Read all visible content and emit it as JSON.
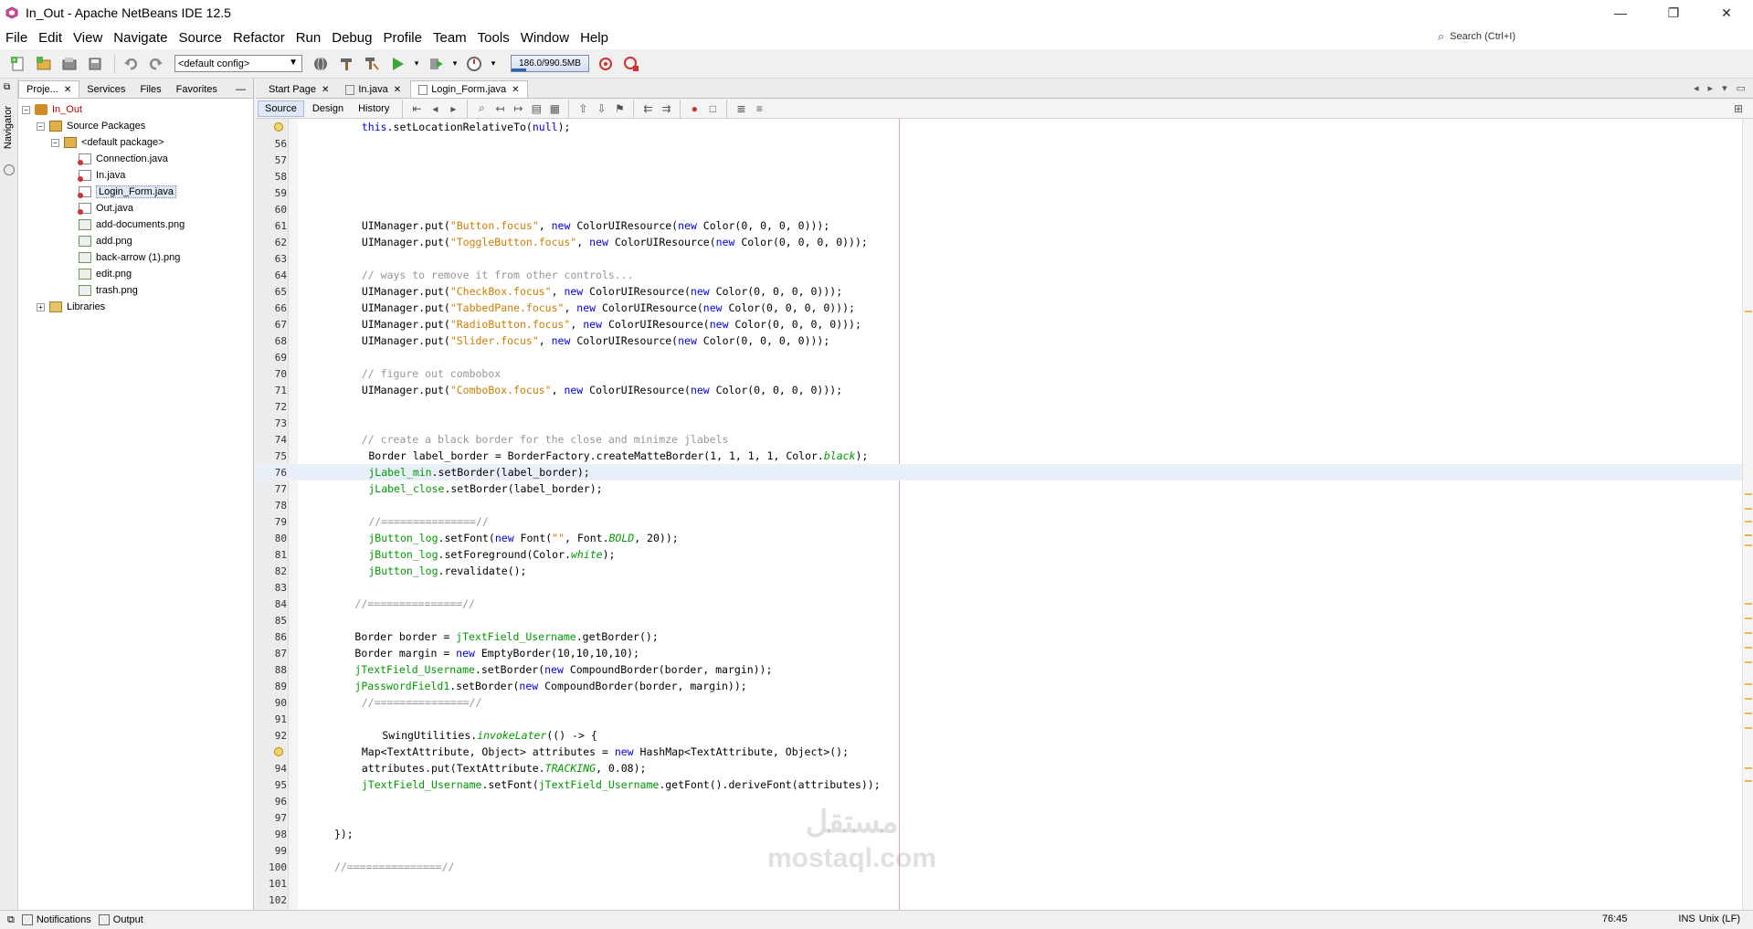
{
  "window": {
    "title": "In_Out - Apache NetBeans IDE 12.5",
    "minimize": "—",
    "maximize": "❐",
    "close": "✕"
  },
  "menu": [
    "File",
    "Edit",
    "View",
    "Navigate",
    "Source",
    "Refactor",
    "Run",
    "Debug",
    "Profile",
    "Team",
    "Tools",
    "Window",
    "Help"
  ],
  "search": {
    "placeholder": "Search (Ctrl+I)"
  },
  "toolbar": {
    "config": "<default config>",
    "memory": "186.0/990.5MB",
    "memory_fraction": 0.188
  },
  "left_strip": {
    "navigator": "Navigator"
  },
  "project_panel": {
    "tabs": [
      "Proje...",
      "Services",
      "Files",
      "Favorites"
    ],
    "tree": [
      {
        "label": "In_Out",
        "level": 0,
        "icon": "project-icon",
        "toggle": "−",
        "red": true
      },
      {
        "label": "Source Packages",
        "level": 1,
        "icon": "package-folder-icon",
        "toggle": "−"
      },
      {
        "label": "<default package>",
        "level": 2,
        "icon": "package-icon",
        "toggle": "−"
      },
      {
        "label": "Connection.java",
        "level": 3,
        "icon": "java-file-icon"
      },
      {
        "label": "In.java",
        "level": 3,
        "icon": "java-file-icon"
      },
      {
        "label": "Login_Form.java",
        "level": 3,
        "icon": "java-file-icon",
        "selected": true
      },
      {
        "label": "Out.java",
        "level": 3,
        "icon": "java-file-icon"
      },
      {
        "label": "add-documents.png",
        "level": 3,
        "icon": "image-file-icon"
      },
      {
        "label": "add.png",
        "level": 3,
        "icon": "image-file-icon"
      },
      {
        "label": "back-arrow (1).png",
        "level": 3,
        "icon": "image-file-icon"
      },
      {
        "label": "edit.png",
        "level": 3,
        "icon": "image-file-icon"
      },
      {
        "label": "trash.png",
        "level": 3,
        "icon": "image-file-icon"
      },
      {
        "label": "Libraries",
        "level": 1,
        "icon": "library-icon",
        "toggle": "+"
      }
    ]
  },
  "editor": {
    "tabs": [
      {
        "label": "Start Page",
        "active": false
      },
      {
        "label": "In.java",
        "active": false
      },
      {
        "label": "Login_Form.java",
        "active": true
      }
    ],
    "views": [
      "Source",
      "Design",
      "History"
    ],
    "active_view": "Source",
    "current_line": 76,
    "warning_lines": [
      55,
      93
    ],
    "lines": [
      {
        "n": "",
        "indent": 8,
        "tokens": [
          [
            "kw",
            "this"
          ],
          [
            "",
            "."
          ],
          [
            "",
            "setLocationRelativeTo"
          ],
          [
            "",
            "("
          ],
          [
            "kw",
            "null"
          ],
          [
            "",
            ");"
          ]
        ]
      },
      {
        "n": "56",
        "indent": 0,
        "tokens": []
      },
      {
        "n": "57",
        "indent": 0,
        "tokens": []
      },
      {
        "n": "58",
        "indent": 0,
        "tokens": []
      },
      {
        "n": "59",
        "indent": 0,
        "tokens": []
      },
      {
        "n": "60",
        "indent": 0,
        "tokens": []
      },
      {
        "n": "61",
        "indent": 8,
        "tokens": [
          [
            "",
            "UIManager.put("
          ],
          [
            "str",
            "\"Button.focus\""
          ],
          [
            "",
            ", "
          ],
          [
            "kw",
            "new"
          ],
          [
            "",
            " ColorUIResource("
          ],
          [
            "kw",
            "new"
          ],
          [
            "",
            " Color(0, 0, 0, 0)));"
          ]
        ]
      },
      {
        "n": "62",
        "indent": 8,
        "tokens": [
          [
            "",
            "UIManager.put("
          ],
          [
            "str",
            "\"ToggleButton.focus\""
          ],
          [
            "",
            ", "
          ],
          [
            "kw",
            "new"
          ],
          [
            "",
            " ColorUIResource("
          ],
          [
            "kw",
            "new"
          ],
          [
            "",
            " Color(0, 0, 0, 0)));"
          ]
        ]
      },
      {
        "n": "63",
        "indent": 0,
        "tokens": []
      },
      {
        "n": "64",
        "indent": 8,
        "tokens": [
          [
            "cmt",
            "// ways to remove it from other controls..."
          ]
        ]
      },
      {
        "n": "65",
        "indent": 8,
        "tokens": [
          [
            "",
            "UIManager.put("
          ],
          [
            "str",
            "\"CheckBox.focus\""
          ],
          [
            "",
            ", "
          ],
          [
            "kw",
            "new"
          ],
          [
            "",
            " ColorUIResource("
          ],
          [
            "kw",
            "new"
          ],
          [
            "",
            " Color(0, 0, 0, 0)));"
          ]
        ]
      },
      {
        "n": "66",
        "indent": 8,
        "tokens": [
          [
            "",
            "UIManager.put("
          ],
          [
            "str",
            "\"TabbedPane.focus\""
          ],
          [
            "",
            ", "
          ],
          [
            "kw",
            "new"
          ],
          [
            "",
            " ColorUIResource("
          ],
          [
            "kw",
            "new"
          ],
          [
            "",
            " Color(0, 0, 0, 0)));"
          ]
        ]
      },
      {
        "n": "67",
        "indent": 8,
        "tokens": [
          [
            "",
            "UIManager.put("
          ],
          [
            "str",
            "\"RadioButton.focus\""
          ],
          [
            "",
            ", "
          ],
          [
            "kw",
            "new"
          ],
          [
            "",
            " ColorUIResource("
          ],
          [
            "kw",
            "new"
          ],
          [
            "",
            " Color(0, 0, 0, 0)));"
          ]
        ]
      },
      {
        "n": "68",
        "indent": 8,
        "tokens": [
          [
            "",
            "UIManager.put("
          ],
          [
            "str",
            "\"Slider.focus\""
          ],
          [
            "",
            ", "
          ],
          [
            "kw",
            "new"
          ],
          [
            "",
            " ColorUIResource("
          ],
          [
            "kw",
            "new"
          ],
          [
            "",
            " Color(0, 0, 0, 0)));"
          ]
        ]
      },
      {
        "n": "69",
        "indent": 0,
        "tokens": []
      },
      {
        "n": "70",
        "indent": 8,
        "tokens": [
          [
            "cmt",
            "// figure out combobox"
          ]
        ]
      },
      {
        "n": "71",
        "indent": 8,
        "tokens": [
          [
            "",
            "UIManager.put("
          ],
          [
            "str",
            "\"ComboBox.focus\""
          ],
          [
            "",
            ", "
          ],
          [
            "kw",
            "new"
          ],
          [
            "",
            " ColorUIResource("
          ],
          [
            "kw",
            "new"
          ],
          [
            "",
            " Color(0, 0, 0, 0)));"
          ]
        ]
      },
      {
        "n": "72",
        "indent": 0,
        "tokens": []
      },
      {
        "n": "73",
        "indent": 0,
        "tokens": []
      },
      {
        "n": "74",
        "indent": 8,
        "tokens": [
          [
            "cmt",
            "// create a black border for the close and minimze jlabels"
          ]
        ]
      },
      {
        "n": "75",
        "indent": 9,
        "tokens": [
          [
            "",
            "Border label_border = BorderFactory."
          ],
          [
            "",
            "createMatteBorder(1, 1, 1, 1, Color."
          ],
          [
            "it",
            "black"
          ],
          [
            "",
            ");"
          ]
        ]
      },
      {
        "n": "76",
        "indent": 9,
        "tokens": [
          [
            "fld",
            "jLabel_min"
          ],
          [
            "",
            ".setBorder(label_border);"
          ]
        ]
      },
      {
        "n": "77",
        "indent": 9,
        "tokens": [
          [
            "fld",
            "jLabel_close"
          ],
          [
            "",
            ".setBorder(label_border);"
          ]
        ]
      },
      {
        "n": "78",
        "indent": 0,
        "tokens": []
      },
      {
        "n": "79",
        "indent": 9,
        "tokens": [
          [
            "cmt",
            "//===============//"
          ]
        ]
      },
      {
        "n": "80",
        "indent": 9,
        "tokens": [
          [
            "fld",
            "jButton_log"
          ],
          [
            "",
            ".setFont("
          ],
          [
            "kw",
            "new"
          ],
          [
            "",
            " Font("
          ],
          [
            "str",
            "\"\""
          ],
          [
            "",
            ", Font."
          ],
          [
            "it",
            "BOLD"
          ],
          [
            "",
            ", 20));"
          ]
        ]
      },
      {
        "n": "81",
        "indent": 9,
        "tokens": [
          [
            "fld",
            "jButton_log"
          ],
          [
            "",
            ".setForeground(Color."
          ],
          [
            "it",
            "white"
          ],
          [
            "",
            ");"
          ]
        ]
      },
      {
        "n": "82",
        "indent": 9,
        "tokens": [
          [
            "fld",
            "jButton_log"
          ],
          [
            "",
            ".revalidate();"
          ]
        ]
      },
      {
        "n": "83",
        "indent": 0,
        "tokens": []
      },
      {
        "n": "84",
        "indent": 7,
        "tokens": [
          [
            "cmt",
            "//===============//"
          ]
        ]
      },
      {
        "n": "85",
        "indent": 0,
        "tokens": []
      },
      {
        "n": "86",
        "indent": 7,
        "tokens": [
          [
            "",
            "Border border = "
          ],
          [
            "fld",
            "jTextField_Username"
          ],
          [
            "",
            ".getBorder();"
          ]
        ]
      },
      {
        "n": "87",
        "indent": 7,
        "tokens": [
          [
            "",
            "Border margin = "
          ],
          [
            "kw",
            "new"
          ],
          [
            "",
            " EmptyBorder(10,10,10,10);"
          ]
        ]
      },
      {
        "n": "88",
        "indent": 7,
        "tokens": [
          [
            "fld",
            "jTextField_Username"
          ],
          [
            "",
            ".setBorder("
          ],
          [
            "kw",
            "new"
          ],
          [
            "",
            " CompoundBorder(border, margin));"
          ]
        ]
      },
      {
        "n": "89",
        "indent": 7,
        "tokens": [
          [
            "fld",
            "jPasswordField1"
          ],
          [
            "",
            ".setBorder("
          ],
          [
            "kw",
            "new"
          ],
          [
            "",
            " CompoundBorder(border, margin));"
          ]
        ]
      },
      {
        "n": "90",
        "indent": 8,
        "tokens": [
          [
            "cmt",
            "//===============//"
          ]
        ]
      },
      {
        "n": "91",
        "indent": 0,
        "tokens": []
      },
      {
        "n": "92",
        "indent": 11,
        "tokens": [
          [
            "",
            "SwingUtilities."
          ],
          [
            "it",
            "invokeLater"
          ],
          [
            "",
            "(() -> {"
          ]
        ]
      },
      {
        "n": "",
        "indent": 8,
        "tokens": [
          [
            "",
            "Map<TextAttribute, Object> attributes = "
          ],
          [
            "kw",
            "new"
          ],
          [
            "",
            " HashMap<TextAttribute, Object>();"
          ]
        ]
      },
      {
        "n": "94",
        "indent": 8,
        "tokens": [
          [
            "",
            "attributes.put(TextAttribute."
          ],
          [
            "it",
            "TRACKING"
          ],
          [
            "",
            ", 0.08);"
          ]
        ]
      },
      {
        "n": "95",
        "indent": 8,
        "tokens": [
          [
            "fld",
            "jTextField_Username"
          ],
          [
            "",
            ".setFont("
          ],
          [
            "fld",
            "jTextField_Username"
          ],
          [
            "",
            ".getFont().deriveFont(attributes));"
          ]
        ]
      },
      {
        "n": "96",
        "indent": 0,
        "tokens": []
      },
      {
        "n": "97",
        "indent": 0,
        "tokens": []
      },
      {
        "n": "98",
        "indent": 4,
        "tokens": [
          [
            "",
            "});"
          ]
        ]
      },
      {
        "n": "99",
        "indent": 0,
        "tokens": []
      },
      {
        "n": "100",
        "indent": 4,
        "tokens": [
          [
            "cmt",
            "//===============//"
          ]
        ]
      },
      {
        "n": "101",
        "indent": 0,
        "tokens": []
      },
      {
        "n": "102",
        "indent": 0,
        "tokens": []
      }
    ]
  },
  "statusbar": {
    "notifications": "Notifications",
    "output": "Output",
    "position": "76:45",
    "mode": "INS",
    "line_endings": "Unix (LF)"
  },
  "watermark": {
    "arabic": "مستقل",
    "latin": "mostaql.com"
  },
  "colors": {
    "keyword": "#0000e6",
    "string": "#ce7b00",
    "comment": "#969696",
    "field": "#009900",
    "current_line": "#e9eff8",
    "margin_line": "#f3a0a0"
  }
}
